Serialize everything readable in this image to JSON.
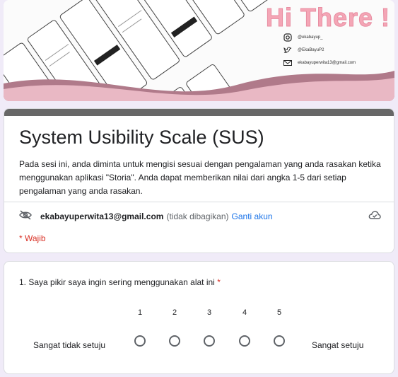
{
  "banner": {
    "greeting": "Hi There !",
    "social": [
      {
        "icon": "instagram-icon",
        "text": "@ekabayup_"
      },
      {
        "icon": "twitter-icon",
        "text": "@EkaBayuP2"
      },
      {
        "icon": "mail-icon",
        "text": "ekabayuperwita13@gmail.com"
      }
    ]
  },
  "form": {
    "title": "System Usibility Scale (SUS)",
    "description": "Pada sesi ini, anda diminta untuk mengisi sesuai dengan pengalaman yang anda rasakan ketika menggunakan aplikasi \"Storia\". Anda dapat memberikan nilai dari angka 1-5 dari setiap pengalaman yang anda rasakan.",
    "account_email": "ekabayuperwita13@gmail.com",
    "account_note": "(tidak dibagikan)",
    "switch_account": "Ganti akun",
    "required_note": "* Wajib"
  },
  "question": {
    "text": "1. Saya pikir saya ingin sering menggunakan alat ini",
    "required_mark": "*",
    "scale": [
      "1",
      "2",
      "3",
      "4",
      "5"
    ],
    "low_label": "Sangat tidak setuju",
    "high_label": "Sangat setuju"
  },
  "colors": {
    "accent": "#1a73e8",
    "required": "#d93025",
    "header_bar": "#676767",
    "background": "#f0ebf8"
  }
}
